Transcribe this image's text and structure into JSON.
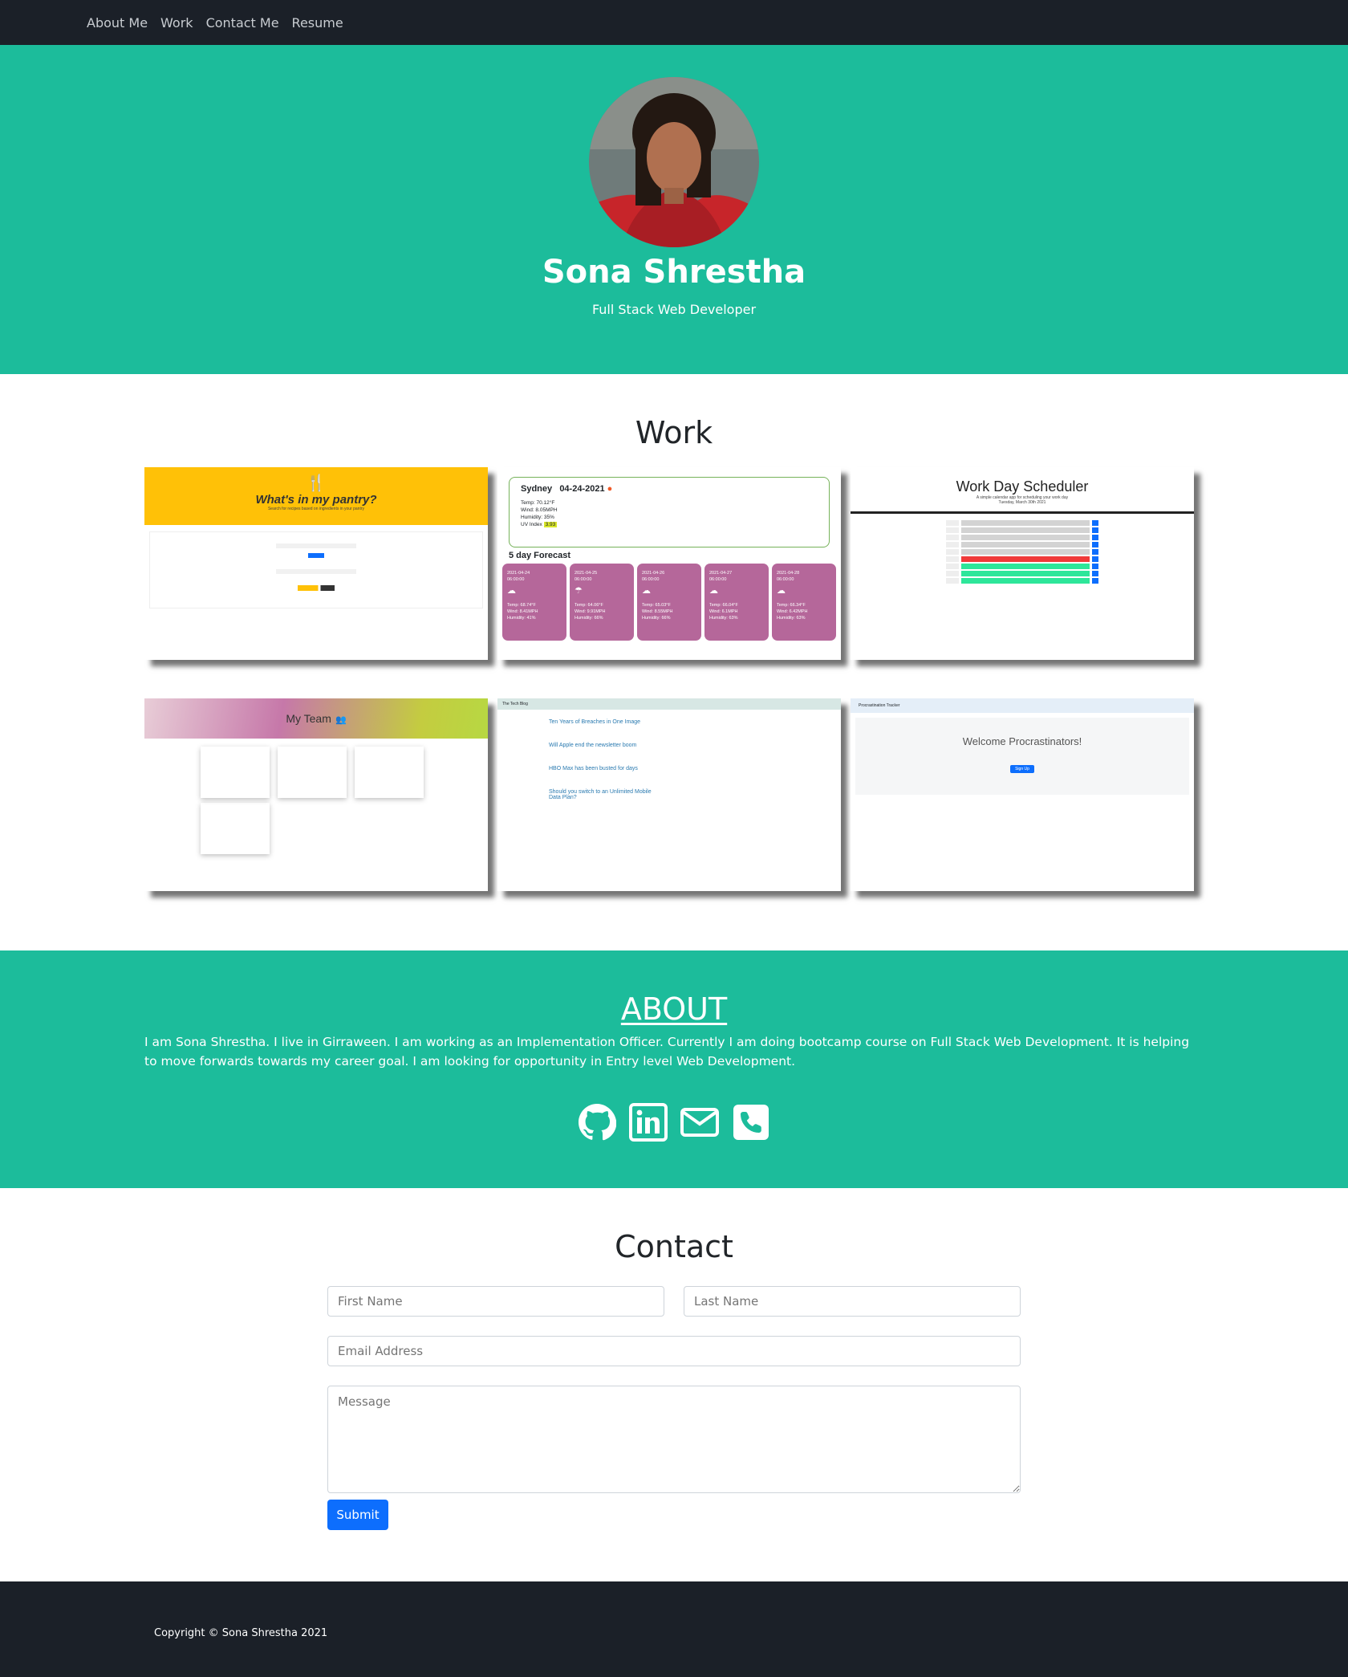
{
  "nav": {
    "items": [
      "About Me",
      "Work",
      "Contact Me",
      "Resume"
    ]
  },
  "hero": {
    "name": "Sona Shrestha",
    "subtitle": "Full Stack Web Developer"
  },
  "work": {
    "title": "Work",
    "cards": [
      {
        "heading": "What's in my pantry?",
        "tagline": "Search for recipes based on ingredients in your pantry"
      },
      {
        "city": "Sydney",
        "date": "04-24-2021",
        "temp": "Temp: 70.12°F",
        "wind": "Wind: 8.05MPH",
        "humidity": "Humidity: 35%",
        "uv": "UV Index",
        "uv_value": "3.93",
        "forecast_title": "5 day Forecast",
        "forecast": [
          {
            "date": "2021-04-24",
            "time": "06:00:00",
            "temp": "Temp: 68.74°F",
            "wind": "Wind: 8.41MPH",
            "hum": "Humidity: 41%"
          },
          {
            "date": "2021-04-25",
            "time": "06:00:00",
            "temp": "Temp: 64.06°F",
            "wind": "Wind: 9.91MPH",
            "hum": "Humidity: 66%"
          },
          {
            "date": "2021-04-26",
            "time": "06:00:00",
            "temp": "Temp: 65.03°F",
            "wind": "Wind: 8.55MPH",
            "hum": "Humidity: 66%"
          },
          {
            "date": "2021-04-27",
            "time": "06:00:00",
            "temp": "Temp: 66.04°F",
            "wind": "Wind: 6.1MPH",
            "hum": "Humidity: 63%"
          },
          {
            "date": "2021-04-28",
            "time": "06:00:00",
            "temp": "Temp: 66.34°F",
            "wind": "Wind: 6.42MPH",
            "hum": "Humidity: 63%"
          }
        ]
      },
      {
        "heading": "Work Day Scheduler",
        "tagline": "A simple calendar app for scheduling your work day",
        "date": "Tuesday, March 30th 2021"
      },
      {
        "heading": "My Team"
      },
      {
        "heading": "The Tech Blog",
        "posts": [
          "Ten Years of Breaches in One Image",
          "Will Apple end the newsletter boom",
          "HBO Max has been busted for days",
          "Should you switch to an Unlimited Mobile Data Plan?"
        ]
      },
      {
        "heading": "Procrastination Tracker",
        "welcome": "Welcome Procrastinators!",
        "button": "Sign Up"
      }
    ]
  },
  "about": {
    "title": "ABOUT",
    "text": "I am Sona Shrestha. I live in Girraween. I am working as an Implementation Officer. Currently I am doing bootcamp course on Full Stack Web Development. It is helping to move forwards towards my career goal. I am looking for opportunity in Entry level Web Development.",
    "icons": [
      "github-icon",
      "linkedin-icon",
      "envelope-icon",
      "phone-icon"
    ]
  },
  "contact": {
    "title": "Contact",
    "first_name": "First Name",
    "last_name": "Last Name",
    "email": "Email Address",
    "message": "Message",
    "submit": "Submit"
  },
  "footer": {
    "copyright": "Copyright © Sona Shrestha 2021"
  }
}
